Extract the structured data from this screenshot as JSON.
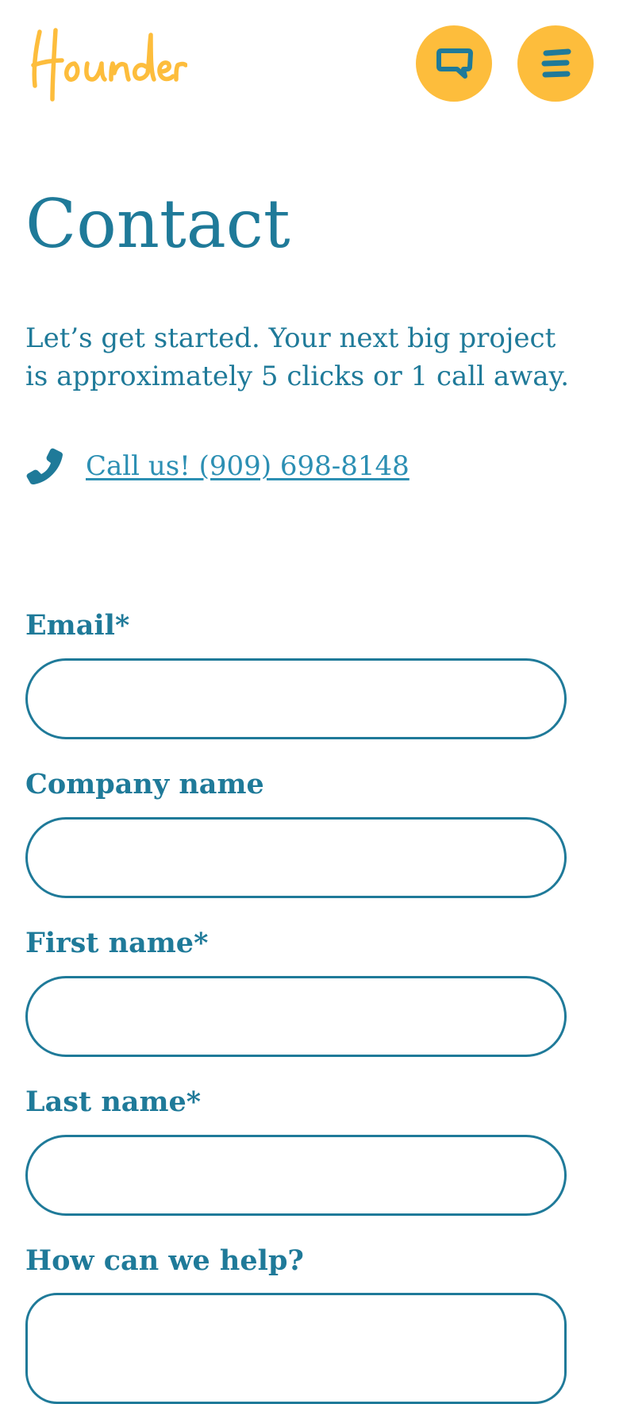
{
  "header": {
    "logo_text": "Hounder",
    "chat_button_icon": "chat-bubble-icon",
    "menu_button_icon": "hamburger-menu-icon"
  },
  "main": {
    "title": "Contact",
    "intro": "Let’s get started. Your next big project is approximately 5 clicks or 1 call away.",
    "phone": {
      "icon": "phone-icon",
      "link_text": "Call us! (909) 698-8148"
    }
  },
  "form": {
    "email_label": "Email*",
    "email_value": "",
    "company_label": "Company name",
    "company_value": "",
    "first_name_label": "First name*",
    "first_name_value": "",
    "last_name_label": "Last name*",
    "last_name_value": "",
    "help_label": "How can we help?",
    "help_value": ""
  },
  "colors": {
    "brand_yellow": "#fdbd3c",
    "brand_teal": "#1f7a99",
    "link_blue": "#2c8fb3",
    "background": "#ffffff"
  }
}
